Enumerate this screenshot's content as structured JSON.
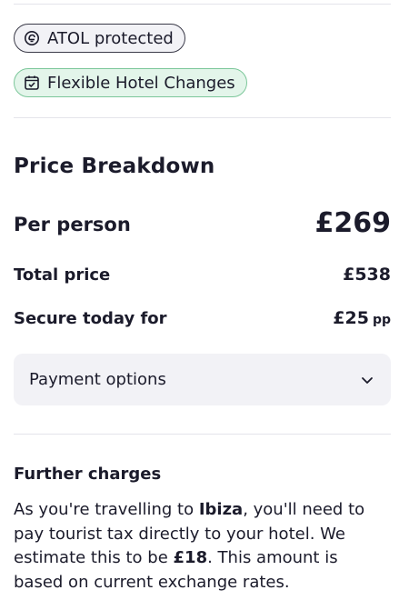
{
  "badges": {
    "atol": {
      "label": "ATOL protected",
      "icon": "atol-shield-icon"
    },
    "flexible": {
      "label": "Flexible Hotel Changes",
      "icon": "calendar-check-icon"
    }
  },
  "price_breakdown": {
    "title": "Price Breakdown",
    "per_person": {
      "label": "Per person",
      "value": "£269"
    },
    "total": {
      "label": "Total price",
      "value": "£538"
    },
    "secure": {
      "label": "Secure today for",
      "value": "£25",
      "suffix": "pp"
    }
  },
  "payment_options": {
    "label": "Payment options",
    "icon": "chevron-down-icon"
  },
  "further_charges": {
    "title": "Further charges",
    "text_1": "As you're travelling to ",
    "destination": "Ibiza",
    "text_2": ", you'll need to pay tourist tax directly to your hotel. We estimate this to be ",
    "amount": "£18",
    "text_3": ". This amount is based on current exchange rates."
  },
  "colors": {
    "text": "#1b1b2b",
    "atol_bg": "#f2f2f6",
    "flex_bg": "#e3f5ea",
    "flex_border": "#7cc79a",
    "panel_bg": "#f2f2f6",
    "divider": "#e4e4ea"
  }
}
